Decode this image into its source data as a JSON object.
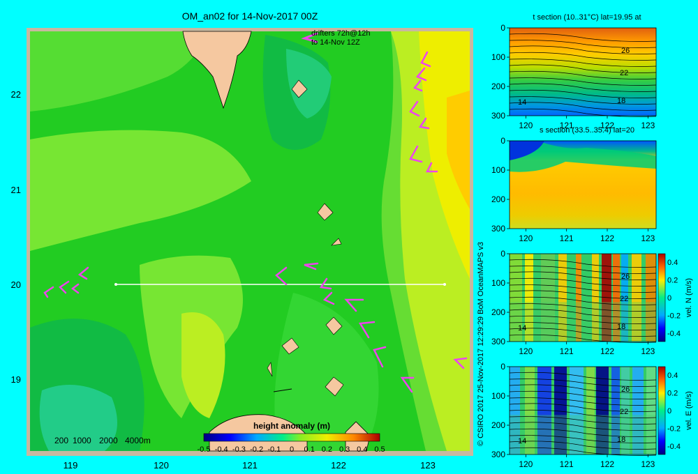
{
  "main_map": {
    "title": "OM_an02 for 14-Nov-2017 00Z",
    "drifter_note_1": "drifters 72h@12h",
    "drifter_note_2": "to 14-Nov 12Z",
    "x_ticks": [
      "119",
      "120",
      "121",
      "122",
      "123"
    ],
    "y_ticks": [
      "22",
      "21",
      "20",
      "19"
    ],
    "depth_legend": [
      "200",
      "1000",
      "2000",
      "4000m"
    ],
    "colorbar_title": "height anomaly (m)",
    "colorbar_ticks": [
      "-0.5",
      "-0.4",
      "-0.3",
      "-0.2",
      "-0.1",
      "0",
      "0.1",
      "0.2",
      "0.3",
      "0.4",
      "0.5"
    ],
    "section_line": {
      "lon": [
        119.5,
        123.2
      ],
      "lat": 20
    },
    "colors": {
      "ocean_mid": "#22cc22",
      "ocean_light": "#88ee33",
      "ocean_dark": "#11bb55",
      "land": "#f5c8a0",
      "frame": "#c8b8a0",
      "drifter": "#ee44ee"
    }
  },
  "chart_data": [
    {
      "type": "heatmap",
      "title": "t section (10..31°C) lat=19.95 at",
      "x_ticks": [
        "120",
        "121",
        "122",
        "123"
      ],
      "y_ticks": [
        "0",
        "100",
        "200",
        "300"
      ],
      "contour_labels": [
        "26",
        "22",
        "18",
        "14"
      ]
    },
    {
      "type": "heatmap",
      "title": "s section (33.5..35.4) lat=20",
      "x_ticks": [
        "120",
        "121",
        "122",
        "123"
      ],
      "y_ticks": [
        "0",
        "100",
        "200",
        "300"
      ]
    },
    {
      "type": "heatmap",
      "title": "",
      "x_ticks": [
        "120",
        "121",
        "122",
        "123"
      ],
      "y_ticks": [
        "0",
        "100",
        "200",
        "300"
      ],
      "contour_labels": [
        "26",
        "22",
        "18",
        "14"
      ],
      "colorbar_label": "vel. N (m/s)",
      "colorbar_ticks": [
        "0.4",
        "0.2",
        "0",
        "-0.2",
        "-0.4"
      ]
    },
    {
      "type": "heatmap",
      "title": "",
      "x_ticks": [
        "120",
        "121",
        "122",
        "123"
      ],
      "y_ticks": [
        "0",
        "100",
        "200",
        "300"
      ],
      "contour_labels": [
        "26",
        "22",
        "18",
        "14"
      ],
      "colorbar_label": "vel. E (m/s)",
      "colorbar_ticks": [
        "0.4",
        "0.2",
        "0",
        "-0.2",
        "-0.4"
      ]
    }
  ],
  "credit": "© CSIRO 2017   25-Nov-2017 12:29:29 BoM OceanMAPS v3"
}
